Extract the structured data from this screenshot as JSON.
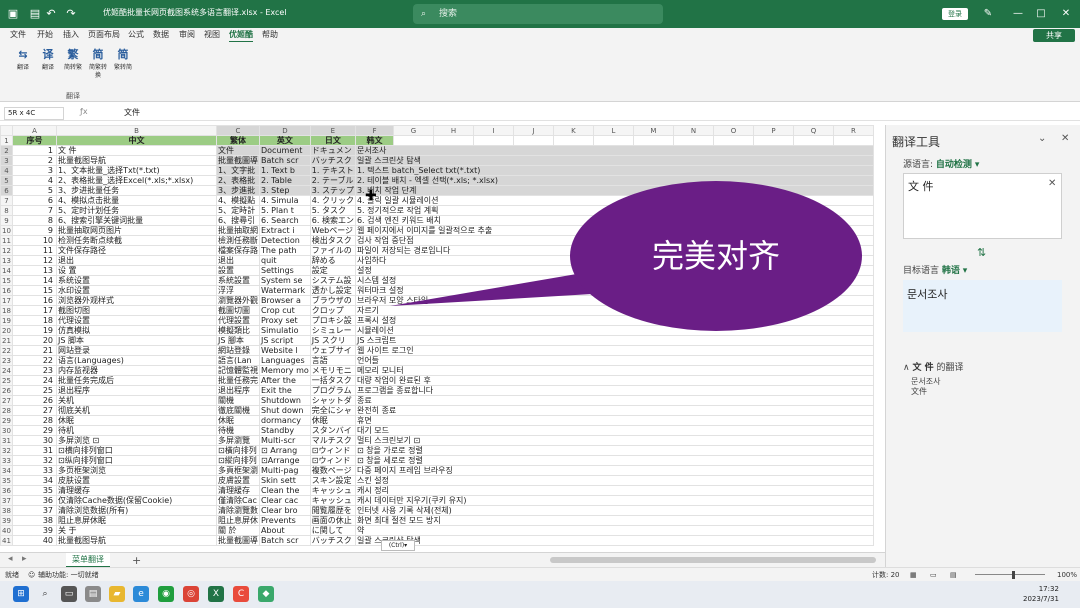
{
  "titlebar": {
    "filename": "优姬酷批量长网页截图系统多语言翻译.xlsx - Excel",
    "search": "搜索",
    "login": "登录",
    "minimize": "—",
    "maximize": "□",
    "close": "✕"
  },
  "menu": {
    "tabs": [
      "文件",
      "开始",
      "插入",
      "页面布局",
      "公式",
      "数据",
      "审阅",
      "视图",
      "优姬酷",
      "帮助"
    ],
    "active": 8,
    "share": "共享"
  },
  "ribbon": {
    "buttons": [
      {
        "icon": "⇆",
        "label": "翻译"
      },
      {
        "icon": "译",
        "label": "翻译"
      },
      {
        "icon": "繁",
        "label": "简转繁"
      },
      {
        "icon": "简",
        "label": "简繁转换"
      },
      {
        "icon": "简",
        "label": "繁转简"
      }
    ],
    "group_label": "翻译"
  },
  "formula": {
    "namebox": "5R x 4C",
    "fx": "ƒx",
    "value": "文件"
  },
  "columns": [
    "A",
    "B",
    "C",
    "D",
    "E",
    "F",
    "G",
    "H",
    "I",
    "J",
    "K",
    "L",
    "M",
    "N",
    "O",
    "P",
    "Q",
    "R"
  ],
  "header_row": [
    "序号",
    "中文",
    "繁体",
    "英文",
    "日文",
    "韩文"
  ],
  "rows": [
    [
      "1",
      "文  件",
      "文件",
      "Document",
      "ドキュメン",
      "문서조사"
    ],
    [
      "2",
      "批量截图导航",
      "批量截圖導",
      "Batch scr",
      "バッチスク",
      "일괄 스크린샷 탐색"
    ],
    [
      "3",
      "1、文本批量_选择Txt(*.txt)",
      "1、文字批",
      "1. Text b",
      "1. テキスト",
      "1. 텍스트 batch_Select txt(*.txt)"
    ],
    [
      "4",
      "2、表格批量_选择Excel(*.xls;*.xlsx)",
      "2、表格批",
      "2. Table",
      "2. テーブル",
      "2. 테이블 배치 - 엑셀 선택(*.xls; *.xlsx)"
    ],
    [
      "5",
      "3、步进批量任务",
      "3、步進批",
      "3. Step",
      "3. ステップ",
      "3. 배치 작업 단계"
    ],
    [
      "6",
      "4、模拟点击批量",
      "4、模擬點",
      "4. Simula",
      "4. クリック",
      "4. 클릭 일괄 시뮬레이션"
    ],
    [
      "7",
      "5、定时计划任务",
      "5、定時計",
      "5. Plan t",
      "5. タスク",
      "5. 정기적으로 작업 계획"
    ],
    [
      "8",
      "6、搜索引擎关键词批量",
      "6、搜尋引",
      "6. Search",
      "6. 検索エン",
      "6. 검색 엔진 키워드 배치"
    ],
    [
      "9",
      "批量抽取网页图片",
      "批量抽取網",
      "Extract i",
      "Webページ",
      "웹 페이지에서 이미지를 일괄적으로 추출"
    ],
    [
      "10",
      "检测任务断点续截",
      "檢測任務斷",
      "Detection",
      "検出タスク",
      "검사 작업 중단점"
    ],
    [
      "11",
      "文件保存路径",
      "檔案保存路",
      "The path",
      "ファイルの",
      "파일이 저장되는 경로입니다"
    ],
    [
      "12",
      "退出",
      "退出",
      "quit",
      "辞める",
      "사임하다"
    ],
    [
      "13",
      "设  置",
      "設置",
      "Settings",
      "設定",
      "설정"
    ],
    [
      "14",
      "系统设置",
      "系統設置",
      "System se",
      "システム設",
      "시스템 설정"
    ],
    [
      "15",
      "水印设置",
      "浮浮",
      "Watermark",
      "透かし設定",
      "워터마크 설정"
    ],
    [
      "16",
      "浏览器外观样式",
      "瀏覽器外觀",
      "Browser a",
      "ブラウザの",
      "브라우저 모양 스타일"
    ],
    [
      "17",
      "截图切图",
      "截圖切圖",
      "Crop cut",
      "クロップ",
      "자르기"
    ],
    [
      "18",
      "代理设置",
      "代理設置",
      "Proxy set",
      "プロキシ設",
      "프록시 설정"
    ],
    [
      "19",
      "仿真模拟",
      "模擬類比",
      "Simulatio",
      "シミュレー",
      "시뮬레이션"
    ],
    [
      "20",
      "JS 脚本",
      "JS 腳本",
      "JS script",
      "JS スクリ",
      "JS 스크립트"
    ],
    [
      "21",
      "网站登录",
      "網站登錄",
      "Website l",
      "ウェブサイ",
      "웹 사이트 로그인"
    ],
    [
      "22",
      "语言(Languages)",
      "語言(Lan",
      "Languages",
      "言語",
      "언어들"
    ],
    [
      "23",
      "内存监视器",
      "記憶體監視",
      "Memory mo",
      "メモリモニ",
      "메모리 모니터"
    ],
    [
      "24",
      "批量任务完成后",
      "批量任務完",
      "After the",
      "一括タスク",
      "대량 작업이 완료된 후"
    ],
    [
      "25",
      "退出程序",
      "退出程序",
      "Exit the",
      "プログラム",
      "프로그램을 종료합니다"
    ],
    [
      "26",
      "关机",
      "關機",
      "Shutdown",
      "シャットダ",
      "종료"
    ],
    [
      "27",
      "彻底关机",
      "徹底關機",
      "Shut down",
      "完全にシャ",
      "완전히 종료"
    ],
    [
      "28",
      "休眠",
      "休眠",
      "dormancy",
      "休眠",
      "휴면"
    ],
    [
      "29",
      "待机",
      "待機",
      "Standby",
      "スタンバイ",
      "대기 모드"
    ],
    [
      "30",
      "多屏浏览 ⊡",
      "多屏瀏覽",
      "Multi-scr",
      "マルチスク",
      "멀티 스크린보기 ⊡"
    ],
    [
      "31",
      "⊡横向排列窗口",
      "⊡橫向排列",
      "⊡ Arrang",
      "⊡ウィンド",
      "⊡ 창을 가로로 정렬"
    ],
    [
      "32",
      "⊡纵向排列窗口",
      "⊡縱向排列",
      "⊡Arrange",
      "⊡ウィンド",
      "⊡ 창을 세로로 정렬"
    ],
    [
      "33",
      "多页框架浏览",
      "多頁框架瀏",
      "Multi-pag",
      "複数ページ",
      "다중 페이지 프레임 브라우징"
    ],
    [
      "34",
      "皮肤设置",
      "皮膚設置",
      "Skin sett",
      "スキン設定",
      "스킨 설정"
    ],
    [
      "35",
      "清理缓存",
      "清理緩存",
      "Clean the",
      "キャッシュ",
      "캐시 정리"
    ],
    [
      "36",
      "仅清除Cache数据(保留Cookie)",
      "僅清除Cac",
      "Clear cac",
      "キャッシュ",
      "캐시 데이터만 지우기(쿠키 유지)"
    ],
    [
      "37",
      "清除浏览数据(所有)",
      "清除瀏覽數",
      "Clear bro",
      "閲覧履歴を",
      "인터넷 사용 기록 삭제(전체)"
    ],
    [
      "38",
      "阻止息屏休眠",
      "阻止息屏休",
      "Prevents",
      "画面の休止",
      "화면 최대 절전 모드 방지"
    ],
    [
      "39",
      "关  于",
      "關 於",
      "About",
      "に関して",
      "약"
    ],
    [
      "40",
      "批量截图导航",
      "批量截圖導",
      "Batch scr",
      "バッチスク",
      "일괄 스크린샷 탐색"
    ]
  ],
  "overlay": {
    "bubble": "完美对齐",
    "paste_ctrl": "(Ctrl)▾"
  },
  "sheet": {
    "tab": "菜单翻译",
    "add": "+"
  },
  "status": {
    "left": "就绪",
    "accessibility": "辅助功能: 一切就绪",
    "count": "计数: 20",
    "zoom": "100%"
  },
  "pane": {
    "title": "翻译工具",
    "source_label": "源语言:",
    "source_value": "自动检测",
    "source_text": "文 件",
    "target_label": "目标语言",
    "target_value": "韩语",
    "target_text": "문서조사",
    "result_heading_word": "文 件",
    "result_heading_suffix": "的翻译",
    "result_line1": "문서조사",
    "result_line2": "文件"
  },
  "taskbar": {
    "time": "17:32",
    "date": "2023/7/31"
  },
  "colors": {
    "excel_green": "#217346",
    "header_fill": "#9ccc84",
    "bubble": "#6a1e86"
  }
}
